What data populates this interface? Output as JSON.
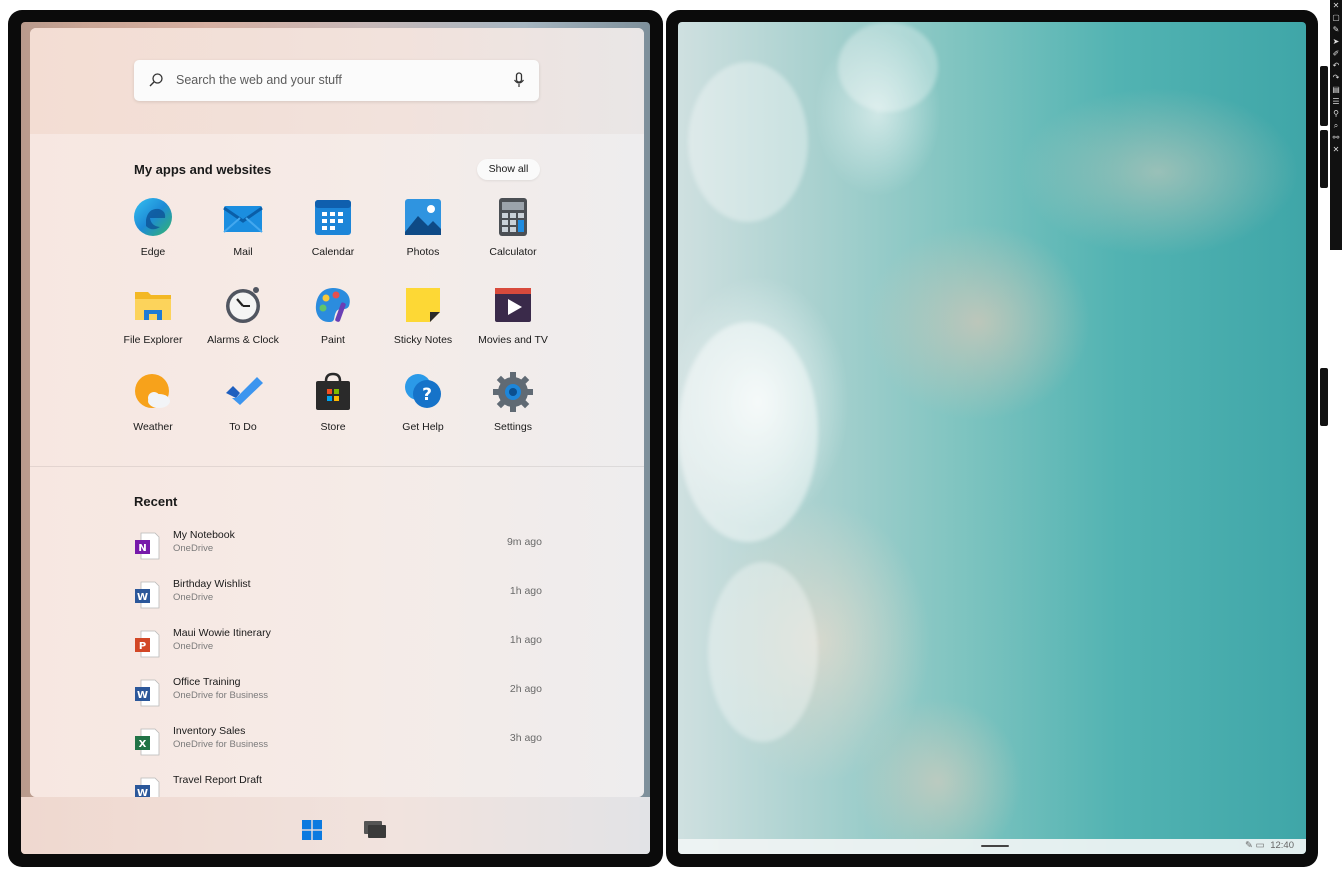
{
  "search": {
    "placeholder": "Search the web and your stuff"
  },
  "apps": {
    "title": "My apps and websites",
    "show_all_label": "Show all",
    "items": [
      {
        "label": "Edge",
        "icon": "edge-icon"
      },
      {
        "label": "Mail",
        "icon": "mail-icon"
      },
      {
        "label": "Calendar",
        "icon": "calendar-icon"
      },
      {
        "label": "Photos",
        "icon": "photos-icon"
      },
      {
        "label": "Calculator",
        "icon": "calculator-icon"
      },
      {
        "label": "File Explorer",
        "icon": "file-explorer-icon"
      },
      {
        "label": "Alarms & Clock",
        "icon": "alarms-clock-icon"
      },
      {
        "label": "Paint",
        "icon": "paint-icon"
      },
      {
        "label": "Sticky Notes",
        "icon": "sticky-notes-icon"
      },
      {
        "label": "Movies and TV",
        "icon": "movies-tv-icon"
      },
      {
        "label": "Weather",
        "icon": "weather-icon"
      },
      {
        "label": "To Do",
        "icon": "todo-icon"
      },
      {
        "label": "Store",
        "icon": "store-icon"
      },
      {
        "label": "Get Help",
        "icon": "get-help-icon"
      },
      {
        "label": "Settings",
        "icon": "settings-icon"
      }
    ]
  },
  "recent": {
    "title": "Recent",
    "items": [
      {
        "name": "My Notebook",
        "location": "OneDrive",
        "time": "9m ago",
        "icon": "onenote-file-icon"
      },
      {
        "name": "Birthday Wishlist",
        "location": "OneDrive",
        "time": "1h ago",
        "icon": "word-file-icon"
      },
      {
        "name": "Maui Wowie Itinerary",
        "location": "OneDrive",
        "time": "1h ago",
        "icon": "powerpoint-file-icon"
      },
      {
        "name": "Office Training",
        "location": "OneDrive for Business",
        "time": "2h ago",
        "icon": "word-file-icon"
      },
      {
        "name": "Inventory Sales",
        "location": "OneDrive for Business",
        "time": "3h ago",
        "icon": "excel-file-icon"
      },
      {
        "name": "Travel Report Draft",
        "location": "",
        "time": "",
        "icon": "word-file-icon"
      }
    ]
  },
  "taskbar": {
    "clock": "12:40"
  },
  "colors": {
    "accent": "#0078d4",
    "ocean": "#3fa6a8",
    "panel": "#f7e7e1"
  }
}
